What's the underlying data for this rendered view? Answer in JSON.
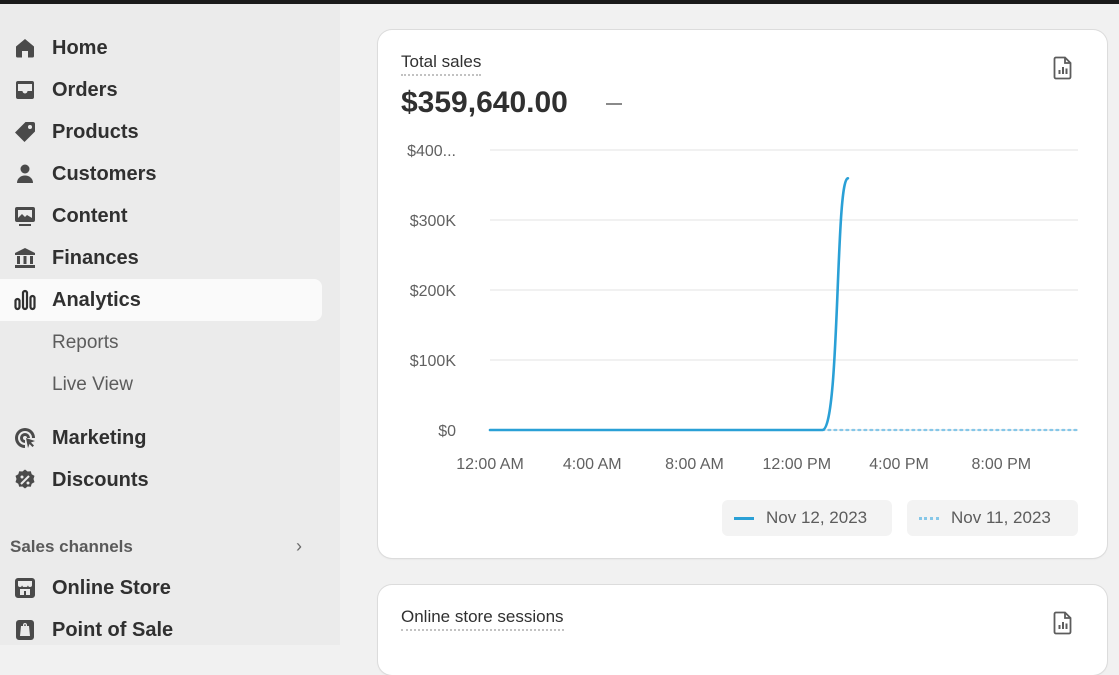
{
  "sidebar": {
    "items": [
      {
        "label": "Home",
        "icon": "home-icon"
      },
      {
        "label": "Orders",
        "icon": "inbox-icon"
      },
      {
        "label": "Products",
        "icon": "tag-icon"
      },
      {
        "label": "Customers",
        "icon": "person-icon"
      },
      {
        "label": "Content",
        "icon": "image-icon"
      },
      {
        "label": "Finances",
        "icon": "bank-icon"
      },
      {
        "label": "Analytics",
        "icon": "bar-chart-icon",
        "active": true
      }
    ],
    "analytics_subitems": [
      {
        "label": "Reports"
      },
      {
        "label": "Live View"
      }
    ],
    "more_items": [
      {
        "label": "Marketing",
        "icon": "target-icon"
      },
      {
        "label": "Discounts",
        "icon": "discount-icon"
      }
    ],
    "sales_channels": {
      "label": "Sales channels",
      "items": [
        {
          "label": "Online Store",
          "icon": "store-icon"
        },
        {
          "label": "Point of Sale",
          "icon": "pos-icon"
        }
      ]
    }
  },
  "total_sales_card": {
    "title": "Total sales",
    "value": "$359,640.00",
    "icon": "report-icon"
  },
  "sessions_card": {
    "title": "Online store sessions",
    "icon": "report-icon"
  },
  "colors": {
    "current_series": "#2aa0d6",
    "previous_series": "#86c7e8"
  },
  "chart_data": {
    "type": "line",
    "x_tick_labels": [
      "12:00 AM",
      "4:00 AM",
      "8:00 AM",
      "12:00 PM",
      "4:00 PM",
      "8:00 PM"
    ],
    "y_tick_labels": [
      "$0",
      "$100K",
      "$200K",
      "$300K",
      "$400..."
    ],
    "ylim": [
      0,
      400000
    ],
    "xlim_hours": [
      0,
      23
    ],
    "grid": true,
    "legend_position": "bottom-right",
    "series": [
      {
        "name": "Nov 12, 2023",
        "style": "solid",
        "x_hours": [
          0,
          1,
          2,
          3,
          4,
          5,
          6,
          7,
          8,
          9,
          10,
          11,
          12,
          13,
          14
        ],
        "values": [
          0,
          0,
          0,
          0,
          0,
          0,
          0,
          0,
          0,
          0,
          0,
          0,
          0,
          0,
          359640
        ]
      },
      {
        "name": "Nov 11, 2023",
        "style": "dotted",
        "x_hours": [
          13,
          23
        ],
        "values": [
          0,
          0
        ]
      }
    ]
  }
}
